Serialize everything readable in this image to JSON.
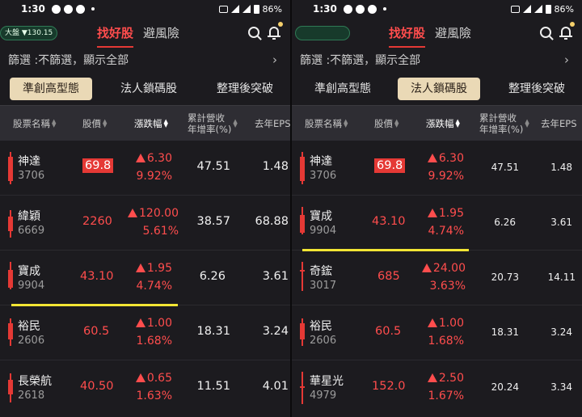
{
  "status": {
    "time": "1:30",
    "battery": "86%"
  },
  "market_badge": "大盤 ▼130.15",
  "top_tabs": [
    "找好股",
    "避風險"
  ],
  "filter": "篩選 :不篩選，顯示全部",
  "chips": [
    "準創高型態",
    "法人鎖碼股",
    "整理後突破"
  ],
  "columns": {
    "name": "股票名稱",
    "price": "股價",
    "change": "漲跌幅",
    "rev_line1": "累計營收",
    "rev_line2": "年增率(%)",
    "eps": "去年EPS"
  },
  "colors": {
    "up": "#ff4d4d",
    "candle": "#e53935",
    "accent": "#e53935",
    "chip_active": "#ead9b6",
    "highlight_line": "#f2e534"
  },
  "left_rows": [
    {
      "name": "神達",
      "code": "3706",
      "price": "69.8",
      "change": "6.30",
      "pct": "9.92%",
      "rev": "47.51",
      "eps": "1.48"
    },
    {
      "name": "緯穎",
      "code": "6669",
      "price": "2260",
      "change": "120.00",
      "pct": "5.61%",
      "rev": "38.57",
      "eps": "68.88"
    },
    {
      "name": "寶成",
      "code": "9904",
      "price": "43.10",
      "change": "1.95",
      "pct": "4.74%",
      "rev": "6.26",
      "eps": "3.61"
    },
    {
      "name": "裕民",
      "code": "2606",
      "price": "60.5",
      "change": "1.00",
      "pct": "1.68%",
      "rev": "18.31",
      "eps": "3.24"
    },
    {
      "name": "長榮航",
      "code": "2618",
      "price": "40.50",
      "change": "0.65",
      "pct": "1.63%",
      "rev": "11.51",
      "eps": "4.01"
    }
  ],
  "right_rows": [
    {
      "name": "神達",
      "code": "3706",
      "price": "69.8",
      "change": "6.30",
      "pct": "9.92%",
      "rev": "47.51",
      "eps": "1.48"
    },
    {
      "name": "寶成",
      "code": "9904",
      "price": "43.10",
      "change": "1.95",
      "pct": "4.74%",
      "rev": "6.26",
      "eps": "3.61"
    },
    {
      "name": "奇鋐",
      "code": "3017",
      "price": "685",
      "change": "24.00",
      "pct": "3.63%",
      "rev": "20.73",
      "eps": "14.11"
    },
    {
      "name": "裕民",
      "code": "2606",
      "price": "60.5",
      "change": "1.00",
      "pct": "1.68%",
      "rev": "18.31",
      "eps": "3.24"
    },
    {
      "name": "華星光",
      "code": "4979",
      "price": "152.0",
      "change": "2.50",
      "pct": "1.67%",
      "rev": "20.24",
      "eps": "3.34"
    }
  ]
}
